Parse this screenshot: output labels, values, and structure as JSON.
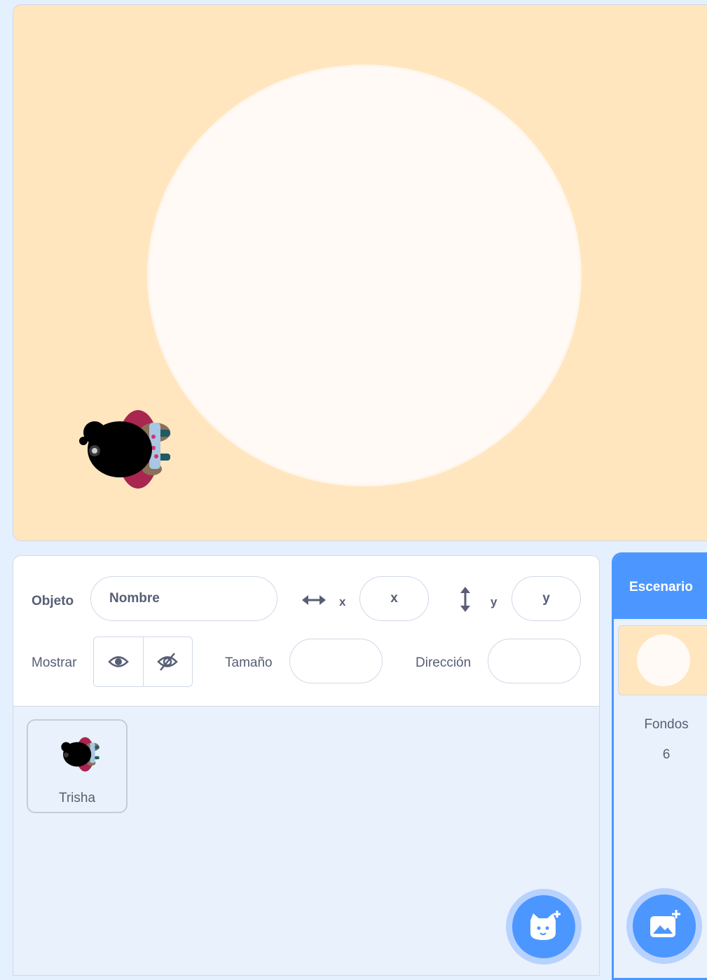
{
  "stage": {
    "sprite_name": "Trisha"
  },
  "sprite_info": {
    "object_label": "Objeto",
    "name_placeholder": "Nombre",
    "x_label": "x",
    "x_placeholder": "x",
    "y_label": "y",
    "y_placeholder": "y",
    "show_label": "Mostrar",
    "size_label": "Tamaño",
    "direction_label": "Dirección",
    "show_icon": "eye-icon",
    "hide_icon": "eye-slash-icon"
  },
  "sprites": [
    {
      "name": "Trisha",
      "selected": false
    }
  ],
  "stage_panel": {
    "tab_label": "Escenario",
    "backdrops_label": "Fondos",
    "backdrops_count": "6"
  },
  "buttons": {
    "choose_sprite_icon": "cat-plus-icon",
    "choose_backdrop_icon": "image-plus-icon"
  },
  "colors": {
    "accent": "#4c97ff",
    "stage_background": "#ffe6bf",
    "panel_background": "#e9f1fc"
  }
}
